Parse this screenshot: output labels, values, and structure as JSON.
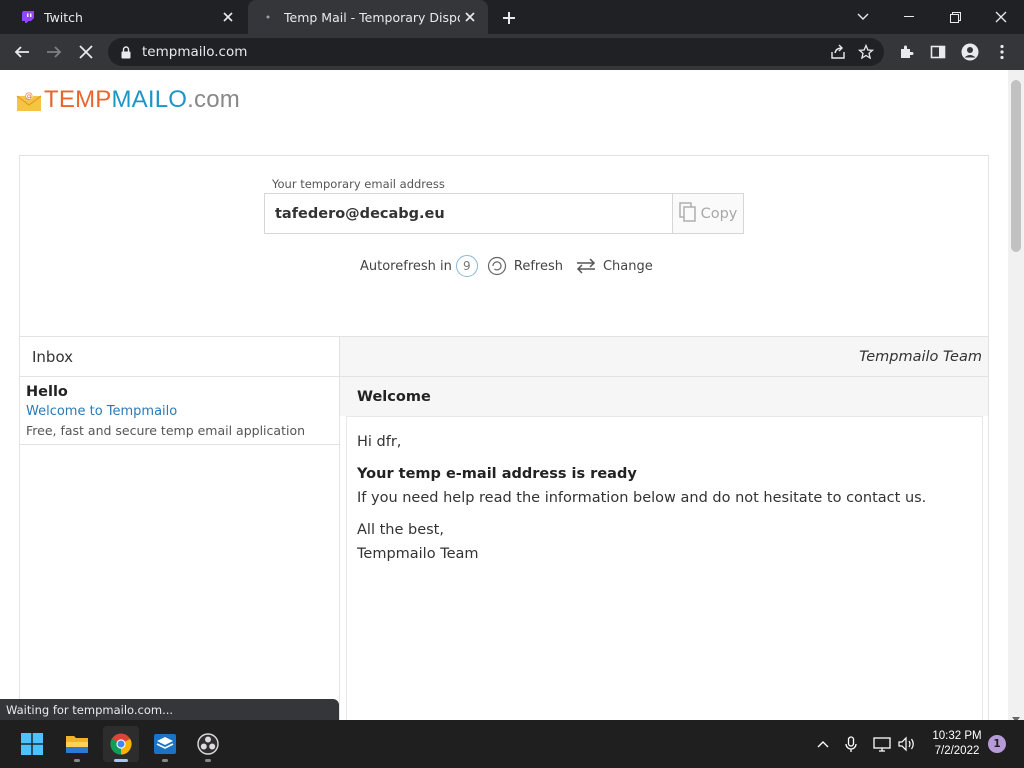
{
  "browser": {
    "tabs": [
      {
        "title": "Twitch",
        "active": false
      },
      {
        "title": "Temp Mail - Temporary Disposab",
        "active": true
      }
    ],
    "url": "tempmailo.com",
    "status_text": "Waiting for tempmailo.com..."
  },
  "site": {
    "logo": {
      "part1": "TEMP",
      "part2": "MAILO",
      "part3": ".com"
    },
    "address_label": "Your temporary email address",
    "email_address": "tafedero@decabg.eu",
    "copy_label": "Copy",
    "autorefresh_label": "Autorefresh in",
    "autorefresh_seconds": "9",
    "refresh_label": "Refresh",
    "change_label": "Change",
    "inbox_title": "Inbox",
    "sender_header": "Tempmailo Team",
    "messages": [
      {
        "from": "Hello",
        "subject": "Welcome to Tempmailo",
        "preview": "Free, fast and secure temp email application"
      }
    ],
    "open_message": {
      "subject": "Welcome",
      "greeting": "Hi dfr,",
      "heading": "Your temp e-mail address is ready",
      "line1": "If you need help read the information below and do not hesitate to contact us.",
      "signoff1": "All the best,",
      "signoff2": "Tempmailo Team"
    }
  },
  "taskbar": {
    "time": "10:32 PM",
    "date": "7/2/2022",
    "notification_count": "1"
  },
  "colors": {
    "logo_orange": "#e8662e",
    "logo_blue": "#1c95c7",
    "link_blue": "#2a7ab8",
    "chrome_dark": "#202124"
  }
}
